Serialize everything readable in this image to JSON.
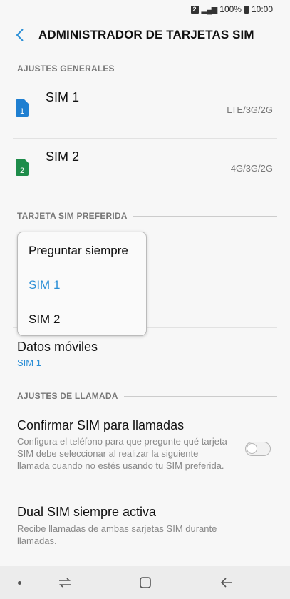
{
  "status_bar": {
    "sim_indicator": "2",
    "battery": "100%",
    "time": "10:00"
  },
  "header": {
    "title": "ADMINISTRADOR DE TARJETAS SIM",
    "back_icon": "chevron-left-icon"
  },
  "sections": {
    "general": "AJUSTES GENERALES",
    "preferred": "TARJETA SIM PREFERIDA",
    "calls": "AJUSTES DE LLAMADA"
  },
  "sims": [
    {
      "name": "SIM 1",
      "network": "LTE/3G/2G",
      "badge": "1",
      "color": "#1f7fd1"
    },
    {
      "name": "SIM 2",
      "network": "4G/3G/2G",
      "badge": "2",
      "color": "#1e8c4a"
    }
  ],
  "preferred": {
    "mobile_data_title": "Datos móviles",
    "mobile_data_value": "SIM 1"
  },
  "dropdown": {
    "options": [
      "Preguntar siempre",
      "SIM 1",
      "SIM 2"
    ],
    "selected_index": 1
  },
  "calls": {
    "confirm_title": "Confirmar SIM para llamadas",
    "confirm_desc": "Configura el teléfono para que pregunte qué tarjeta SIM debe seleccionar al realizar la siguiente llamada cuando no estés usando tu SIM preferida.",
    "confirm_enabled": false,
    "dual_title": "Dual SIM siempre activa",
    "dual_desc": "Recibe llamadas de ambas sarjetas SIM durante llamadas."
  },
  "colors": {
    "accent": "#2b8fd6"
  }
}
